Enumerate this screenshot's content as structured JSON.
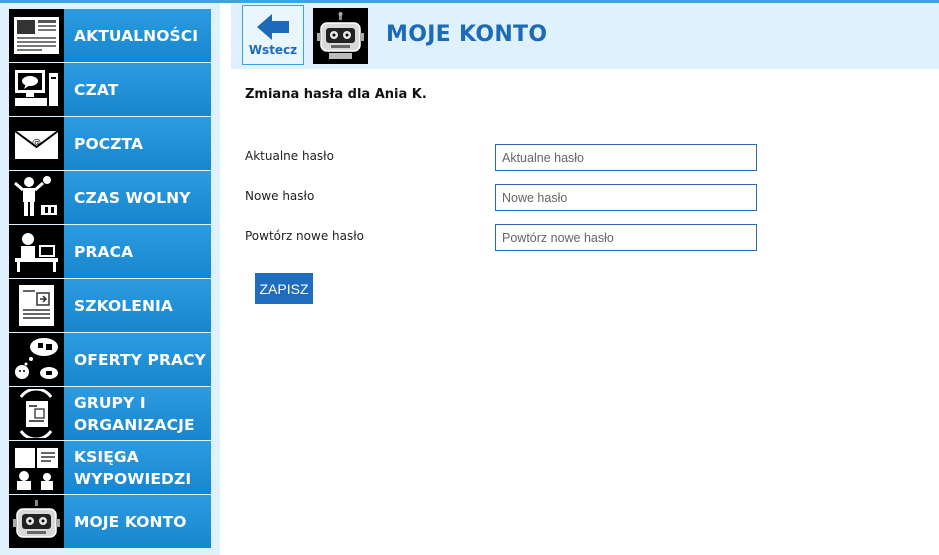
{
  "sidebar": {
    "items": [
      {
        "label": "AKTUALNOŚCI",
        "icon": "newspaper-icon"
      },
      {
        "label": "CZAT",
        "icon": "computer-chat-icon"
      },
      {
        "label": "POCZTA",
        "icon": "envelope-icon"
      },
      {
        "label": "CZAS WOLNY",
        "icon": "leisure-icon"
      },
      {
        "label": "PRACA",
        "icon": "office-work-icon"
      },
      {
        "label": "SZKOLENIA",
        "icon": "training-document-icon"
      },
      {
        "label": "OFERTY PRACY",
        "icon": "job-offers-icon"
      },
      {
        "label": "GRUPY I ORGANIZACJE",
        "icon": "groups-icon"
      },
      {
        "label": "KSIĘGA WYPOWIEDZI",
        "icon": "guestbook-icon"
      },
      {
        "label": "MOJE KONTO",
        "icon": "robot-icon"
      }
    ]
  },
  "header": {
    "back_label": "Wstecz",
    "title": "MOJE KONTO"
  },
  "form": {
    "title": "Zmiana hasła dla Ania K.",
    "current": {
      "label": "Aktualne hasło",
      "placeholder": "Aktualne hasło",
      "value": ""
    },
    "new": {
      "label": "Nowe hasło",
      "placeholder": "Nowe hasło",
      "value": ""
    },
    "repeat": {
      "label": "Powtórz nowe hasło",
      "placeholder": "Powtórz nowe hasło",
      "value": ""
    },
    "save_label": "ZAPISZ"
  },
  "colors": {
    "accent": "#1d6bb8",
    "nav_blue": "#1f8ad6",
    "header_bg": "#dff1fb",
    "button_bg": "#1f6dbf"
  }
}
